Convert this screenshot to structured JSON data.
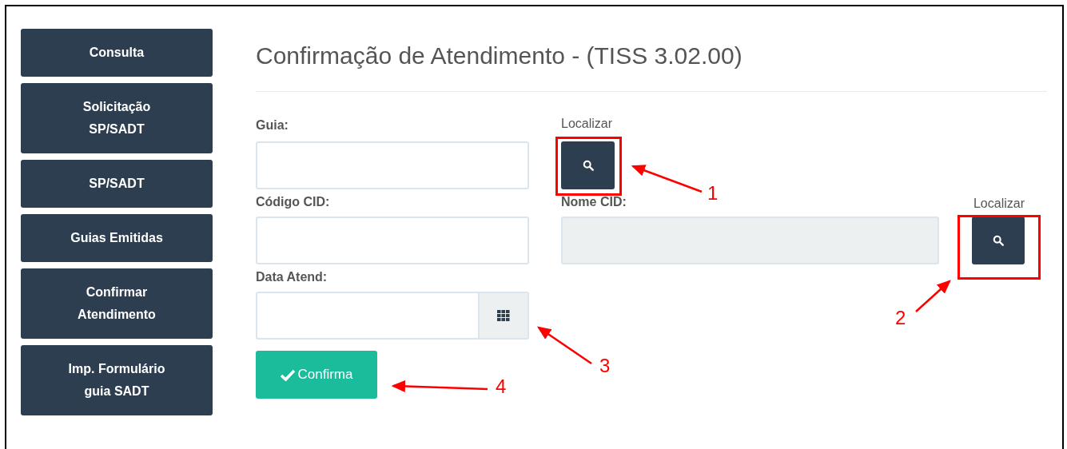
{
  "sidebar": {
    "items": [
      {
        "label": "Consulta"
      },
      {
        "label": "Solicitação\nSP/SADT"
      },
      {
        "label": "SP/SADT"
      },
      {
        "label": "Guias Emitidas"
      },
      {
        "label": "Confirmar\nAtendimento"
      },
      {
        "label": "Imp. Formulário\nguia SADT"
      }
    ]
  },
  "page_title": "Confirmação de Atendimento - (TISS 3.02.00)",
  "form": {
    "guia_label": "Guia:",
    "search_1_label": "Localizar",
    "codigo_cid_label": "Código CID:",
    "nome_cid_label": "Nome CID:",
    "nome_cid_disabled": true,
    "search_2_label": "Localizar",
    "data_atend_label": "Data Atend:",
    "submit": "Confirma"
  },
  "annotations": [
    {
      "label": "1"
    },
    {
      "label": "2"
    },
    {
      "label": "3"
    },
    {
      "label": "4"
    }
  ]
}
